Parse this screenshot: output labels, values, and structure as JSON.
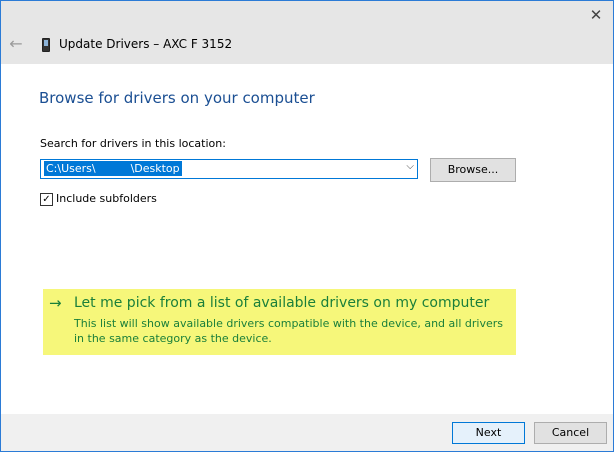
{
  "window": {
    "title": "Update Drivers – AXC F 3152",
    "close_glyph": "✕",
    "back_glyph": "←"
  },
  "main": {
    "heading": "Browse for drivers on your computer",
    "search_label": "Search for drivers in this location:",
    "path_value": "C:\\Users\\          \\Desktop",
    "combo_arrow": "⌵",
    "browse_label": "Browse...",
    "include_subfolders": {
      "label": "Include subfolders",
      "checked": true,
      "glyph": "✓"
    }
  },
  "pick_option": {
    "arrow_glyph": "→",
    "title": "Let me pick from a list of available drivers on my computer",
    "description": "This list will show available drivers compatible with the device, and all drivers in the same category as the device."
  },
  "footer": {
    "next_label": "Next",
    "cancel_label": "Cancel"
  },
  "colors": {
    "heading": "#1b4f93",
    "link_green": "#1a7f3a",
    "highlight": "#f6f77a",
    "selection": "#0078d7"
  }
}
